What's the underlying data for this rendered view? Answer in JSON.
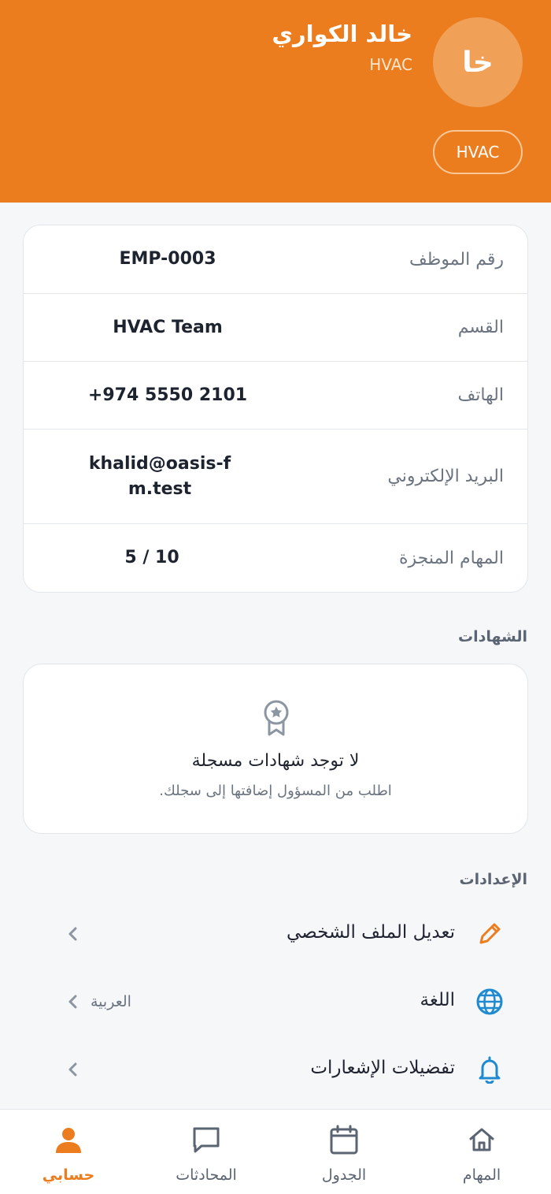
{
  "profile": {
    "avatar_initials": "خا",
    "name": "خالد الكواري",
    "trade": "HVAC",
    "trade_chip": "HVAC"
  },
  "info": {
    "rows": [
      {
        "label": "رقم الموظف",
        "value": "EMP-0003"
      },
      {
        "label": "القسم",
        "value": "HVAC Team"
      },
      {
        "label": "الهاتف",
        "value": "+974 5550 2101"
      },
      {
        "label": "البريد الإلكتروني",
        "value": "khalid@oasis-fm.test"
      },
      {
        "label": "المهام المنجزة",
        "value": "5 / 10"
      }
    ]
  },
  "certificates": {
    "section_title": "الشهادات",
    "empty_title": "لا توجد شهادات مسجلة",
    "empty_subtitle": "اطلب من المسؤول إضافتها إلى سجلك."
  },
  "settings": {
    "section_title": "الإعدادات",
    "items": [
      {
        "label": "تعديل الملف الشخصي",
        "icon": "pencil-icon"
      },
      {
        "label": "اللغة",
        "value": "العربية",
        "icon": "globe-icon"
      },
      {
        "label": "تفضيلات الإشعارات",
        "icon": "bell-icon"
      }
    ]
  },
  "nav": {
    "items": [
      {
        "label": "المهام",
        "icon": "home-icon"
      },
      {
        "label": "الجدول",
        "icon": "calendar-icon"
      },
      {
        "label": "المحادثات",
        "icon": "chat-icon"
      },
      {
        "label": "حسابي",
        "icon": "user-icon",
        "active": true
      }
    ]
  },
  "colors": {
    "brand": "#ec7d1e",
    "settings_icon_blue": "#1f8ad0",
    "text_muted": "#6b7480"
  }
}
